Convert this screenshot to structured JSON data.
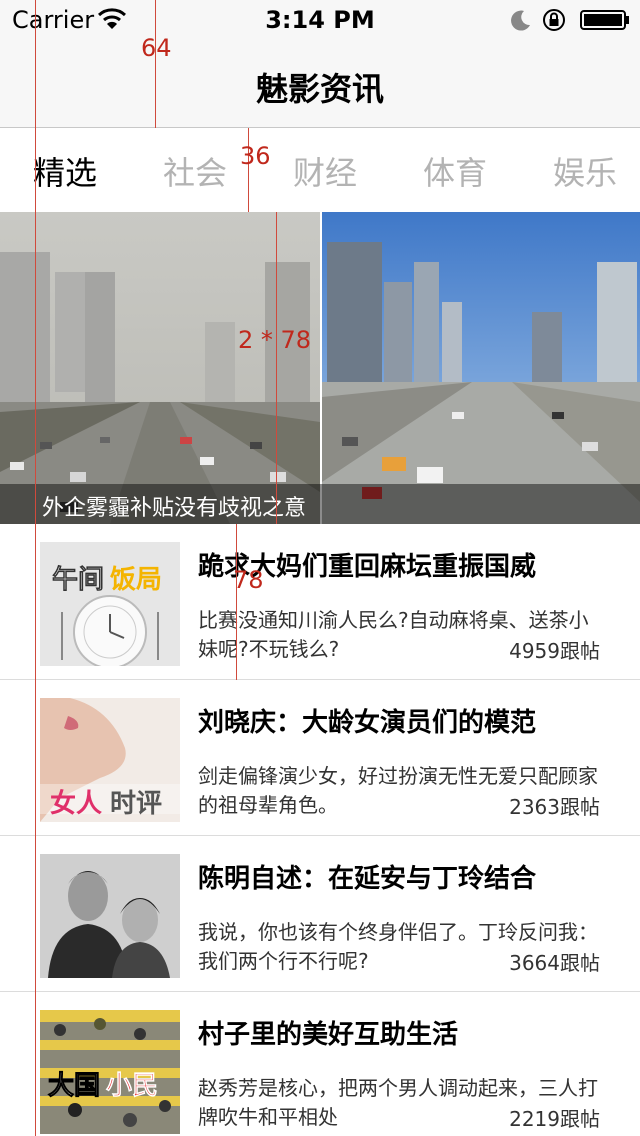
{
  "status_bar": {
    "carrier": "Carrier",
    "time": "3:14 PM"
  },
  "nav": {
    "title": "魅影资讯"
  },
  "tabs": [
    {
      "label": "精选",
      "active": true
    },
    {
      "label": "社会",
      "active": false
    },
    {
      "label": "财经",
      "active": false
    },
    {
      "label": "体育",
      "active": false
    },
    {
      "label": "娱乐",
      "active": false
    }
  ],
  "hero": {
    "caption": "外企雾霾补贴没有歧视之意"
  },
  "news": [
    {
      "title": "跪求大妈们重回麻坛重振国威",
      "digest": "比赛没通知川渝人民么?自动麻将桌、送茶小妹呢?不玩钱么?",
      "replies": "4959跟帖",
      "thumb_text": [
        "午间",
        "饭局"
      ]
    },
    {
      "title": "刘晓庆：大龄女演员们的模范",
      "digest": "剑走偏锋演少女，好过扮演无性无爱只配顾家的祖母辈角色。",
      "replies": "2363跟帖",
      "thumb_text": [
        "女人",
        "时评"
      ]
    },
    {
      "title": "陈明自述：在延安与丁玲结合",
      "digest": "我说，你也该有个终身伴侣了。丁玲反问我：我们两个行不行呢?",
      "replies": "3664跟帖",
      "thumb_text": []
    },
    {
      "title": "村子里的美好互助生活",
      "digest": "赵秀芳是核心，把两个男人调动起来，三人打牌吹牛和平相处",
      "replies": "2219跟帖",
      "thumb_text": [
        "大国",
        "小民"
      ]
    }
  ],
  "annotations": {
    "nav_height": "64",
    "tab_height": "36",
    "hero_height": "2 * 78",
    "row_height": "78"
  }
}
